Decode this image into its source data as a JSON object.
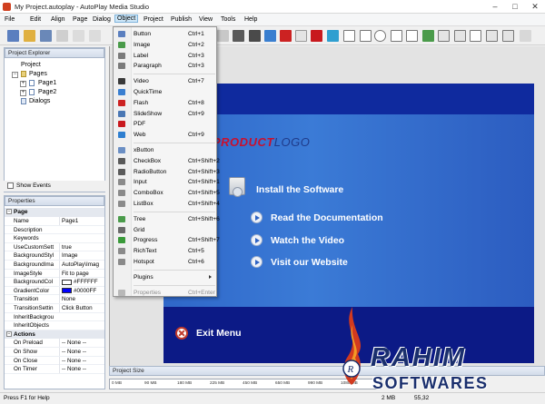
{
  "window": {
    "title": "My Project.autoplay - AutoPlay Media Studio"
  },
  "menubar": [
    "File",
    "Edit",
    "Align",
    "Page",
    "Dialog",
    "Object",
    "Project",
    "Publish",
    "View",
    "Tools",
    "Help"
  ],
  "explorer": {
    "title": "Project Explorer",
    "root": "Project",
    "pages": "Pages",
    "page1": "Page1",
    "page2": "Page2",
    "dialogs": "Dialogs",
    "show_events": "Show Events"
  },
  "properties": {
    "title": "Properties",
    "cat_page": "Page",
    "rows": [
      {
        "name": "Name",
        "value": "Page1"
      },
      {
        "name": "Description",
        "value": ""
      },
      {
        "name": "Keywords",
        "value": ""
      },
      {
        "name": "UseCustomSett",
        "value": "true"
      },
      {
        "name": "BackgroundStyl",
        "value": "Image"
      },
      {
        "name": "BackgroundIma",
        "value": "AutoPlay\\Imag"
      },
      {
        "name": "ImageStyle",
        "value": "Fit to page"
      },
      {
        "name": "BackgroundCol",
        "value": "#FFFFFF"
      },
      {
        "name": "GradientColor",
        "value": "#0000FF"
      },
      {
        "name": "Transition",
        "value": "None"
      },
      {
        "name": "TransitionSettin",
        "value": "Click Button"
      },
      {
        "name": "InheritBackgrou",
        "value": ""
      },
      {
        "name": "InheritObjects",
        "value": ""
      }
    ],
    "cat_actions": "Actions",
    "actions": [
      {
        "name": "On Preload",
        "value": "-- None --"
      },
      {
        "name": "On Show",
        "value": "-- None --"
      },
      {
        "name": "On Close",
        "value": "-- None --"
      },
      {
        "name": "On Timer",
        "value": "-- None --"
      }
    ],
    "colors": {
      "background": "#FFFFFF",
      "gradient": "#0000FF"
    }
  },
  "object_menu": [
    {
      "label": "Button",
      "shortcut": "Ctrl+1",
      "icon": "button-icon",
      "color": "#5b7fbf"
    },
    {
      "label": "Image",
      "shortcut": "Ctrl+2",
      "icon": "image-icon",
      "color": "#4a9b4a"
    },
    {
      "label": "Label",
      "shortcut": "Ctrl+3",
      "icon": "label-icon",
      "color": "#7a7a7a"
    },
    {
      "label": "Paragraph",
      "shortcut": "Ctrl+3",
      "icon": "paragraph-icon",
      "color": "#7a7a7a"
    },
    {
      "sep": true
    },
    {
      "label": "Video",
      "shortcut": "Ctrl+7",
      "icon": "video-icon",
      "color": "#3a3a3a"
    },
    {
      "label": "QuickTime",
      "shortcut": "",
      "icon": "quicktime-icon",
      "color": "#3a7fd0"
    },
    {
      "label": "Flash",
      "shortcut": "Ctrl+8",
      "icon": "flash-icon",
      "color": "#cc2222"
    },
    {
      "label": "SlideShow",
      "shortcut": "Ctrl+9",
      "icon": "slideshow-icon",
      "color": "#4a77b4"
    },
    {
      "label": "PDF",
      "shortcut": "",
      "icon": "pdf-icon",
      "color": "#c8191e"
    },
    {
      "label": "Web",
      "shortcut": "Ctrl+9",
      "icon": "web-icon",
      "color": "#2f7fd0"
    },
    {
      "sep": true
    },
    {
      "label": "xButton",
      "shortcut": "",
      "icon": "xbutton-icon",
      "color": "#6b8fc4"
    },
    {
      "label": "CheckBox",
      "shortcut": "Ctrl+Shift+2",
      "icon": "checkbox-icon",
      "color": "#5a5a5a"
    },
    {
      "label": "RadioButton",
      "shortcut": "Ctrl+Shift+3",
      "icon": "radiobutton-icon",
      "color": "#5a5a5a"
    },
    {
      "label": "Input",
      "shortcut": "Ctrl+Shift+1",
      "icon": "input-icon",
      "color": "#8a8a8a"
    },
    {
      "label": "ComboBox",
      "shortcut": "Ctrl+Shift+5",
      "icon": "combobox-icon",
      "color": "#8a8a8a"
    },
    {
      "label": "ListBox",
      "shortcut": "Ctrl+Shift+4",
      "icon": "listbox-icon",
      "color": "#8a8a8a"
    },
    {
      "sep": true
    },
    {
      "label": "Tree",
      "shortcut": "Ctrl+Shift+6",
      "icon": "tree-icon",
      "color": "#4a9b4a"
    },
    {
      "label": "Grid",
      "shortcut": "",
      "icon": "grid-icon",
      "color": "#6a6a6a"
    },
    {
      "label": "Progress",
      "shortcut": "Ctrl+Shift+7",
      "icon": "progress-icon",
      "color": "#3a9a3a"
    },
    {
      "label": "RichText",
      "shortcut": "Ctrl+5",
      "icon": "richtext-icon",
      "color": "#8a8a8a"
    },
    {
      "label": "Hotspot",
      "shortcut": "Ctrl+6",
      "icon": "hotspot-icon",
      "color": "#8a8a8a"
    },
    {
      "sep": true
    },
    {
      "label": "Plugins",
      "shortcut": "",
      "icon": "",
      "color": "",
      "submenu": true
    },
    {
      "sep": true
    },
    {
      "label": "Properties",
      "shortcut": "Ctrl+Enter",
      "icon": "properties-icon",
      "color": "#b8b8b8",
      "disabled": true
    }
  ],
  "stage": {
    "logo_a": "PRODUCT",
    "logo_b": "LOGO",
    "install": "Install the Software",
    "read": "Read the Documentation",
    "watch": "Watch the Video",
    "visit": "Visit our Website",
    "exit": "Exit Menu"
  },
  "project_size": {
    "title": "Project Size",
    "ticks": [
      "0 MB",
      "90 MB",
      "180 MB",
      "225 MB",
      "450 MB",
      "650 MB",
      "990 MB",
      "1080 MB"
    ]
  },
  "status": {
    "help": "Press F1 for Help",
    "size": "2 MB",
    "coord": "55,32"
  },
  "watermark": {
    "line1": "RAHIM",
    "line2": "SOFTWARES"
  }
}
